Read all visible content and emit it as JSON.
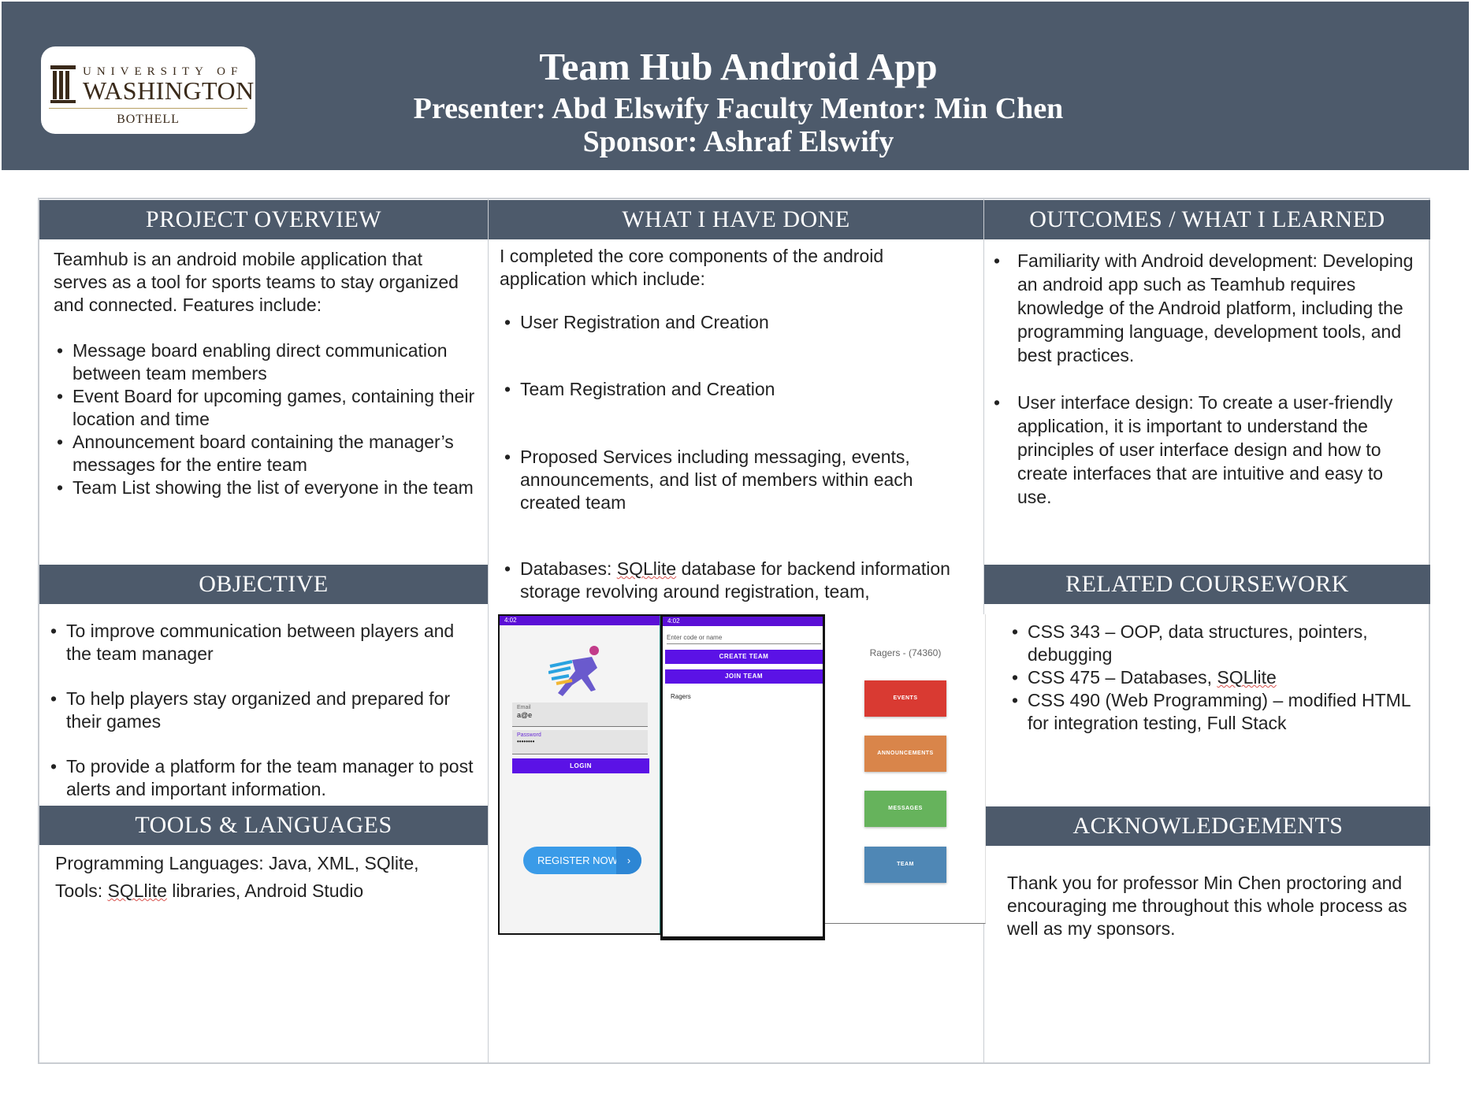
{
  "header": {
    "title": "Team Hub Android App",
    "presenter_line": "Presenter: Abd Elswify  Faculty Mentor: Min Chen",
    "sponsor_line": "Sponsor: Ashraf Elswify",
    "logo": {
      "university_of": "UNIVERSITY OF",
      "washington": "WASHINGTON",
      "campus": "BOTHELL"
    }
  },
  "project_overview": {
    "heading": "PROJECT OVERVIEW",
    "intro": "Teamhub is an android mobile application that serves as a tool for sports teams to stay organized and connected. Features include:",
    "bullets": [
      "Message board enabling direct communication between team members",
      "Event Board for upcoming games, containing their location and time",
      "Announcement board containing the manager’s messages for the entire team",
      "Team List showing the list of everyone in the team"
    ]
  },
  "objective": {
    "heading": "OBJECTIVE",
    "bullets": [
      "To improve communication between players and the team manager",
      "To help players stay organized and prepared for their games",
      "To provide a platform for the team manager to post alerts and important information."
    ]
  },
  "tools": {
    "heading": "TOOLS & LANGUAGES",
    "languages": "Programming Languages: Java, XML, SQlite,",
    "tools_prefix": "Tools: ",
    "tools_sqlite": "SQLlite",
    "tools_rest": " libraries, Android Studio"
  },
  "done": {
    "heading": "WHAT I HAVE DONE",
    "intro": "I completed the core components of the android application which include:",
    "bullets": [
      "User Registration and Creation",
      "Team Registration and Creation",
      "Proposed Services including messaging, events, announcements, and list of members within each created team"
    ],
    "db_prefix": "Databases: ",
    "db_sqlite": "SQLlite",
    "db_rest": " database for backend information storage revolving around registration, team,"
  },
  "screens": {
    "login": {
      "time": "4:02",
      "email_label": "Email",
      "email_value": "a@e",
      "password_label": "Password",
      "password_value": "••••••••",
      "login_button": "LOGIN",
      "register_button": "REGISTER NOW"
    },
    "team": {
      "time": "4:02",
      "search_placeholder": "Enter code or name",
      "create_button": "CREATE TEAM",
      "join_button": "JOIN TEAM",
      "team_item": "Ragers"
    },
    "menu": {
      "team_title": "Ragers - (74360)",
      "events": "EVENTS",
      "announcements": "ANNOUNCEMENTS",
      "messages": "MESSAGES",
      "team": "TEAM"
    }
  },
  "outcomes": {
    "heading": "OUTCOMES / WHAT I LEARNED",
    "bullets": [
      "Familiarity with Android development: Developing an android app such as Teamhub requires knowledge of the Android platform, including the programming language, development tools, and best practices.",
      "User interface design: To create a user-friendly application, it is important to understand the principles of user interface design and how to create interfaces that are intuitive and easy to use."
    ]
  },
  "coursework": {
    "heading": "RELATED COURSEWORK",
    "item1": "CSS 343 – OOP, data structures, pointers, debugging",
    "item2_prefix": "CSS 475 – Databases, ",
    "item2_sqlite": "SQLlite",
    "item3": "CSS 490 (Web Programming) – modified HTML for integration testing, Full Stack"
  },
  "acknowledgements": {
    "heading": "ACKNOWLEDGEMENTS",
    "text": "Thank you for professor Min Chen proctoring and encouraging me throughout this whole process as well as my sponsors."
  },
  "colors": {
    "header_bg": "#4d5a6b",
    "accent_purple": "#5b12e6",
    "events": "#d93a32",
    "announcements": "#d9854a",
    "messages": "#66b35c",
    "team": "#4f87b5"
  }
}
